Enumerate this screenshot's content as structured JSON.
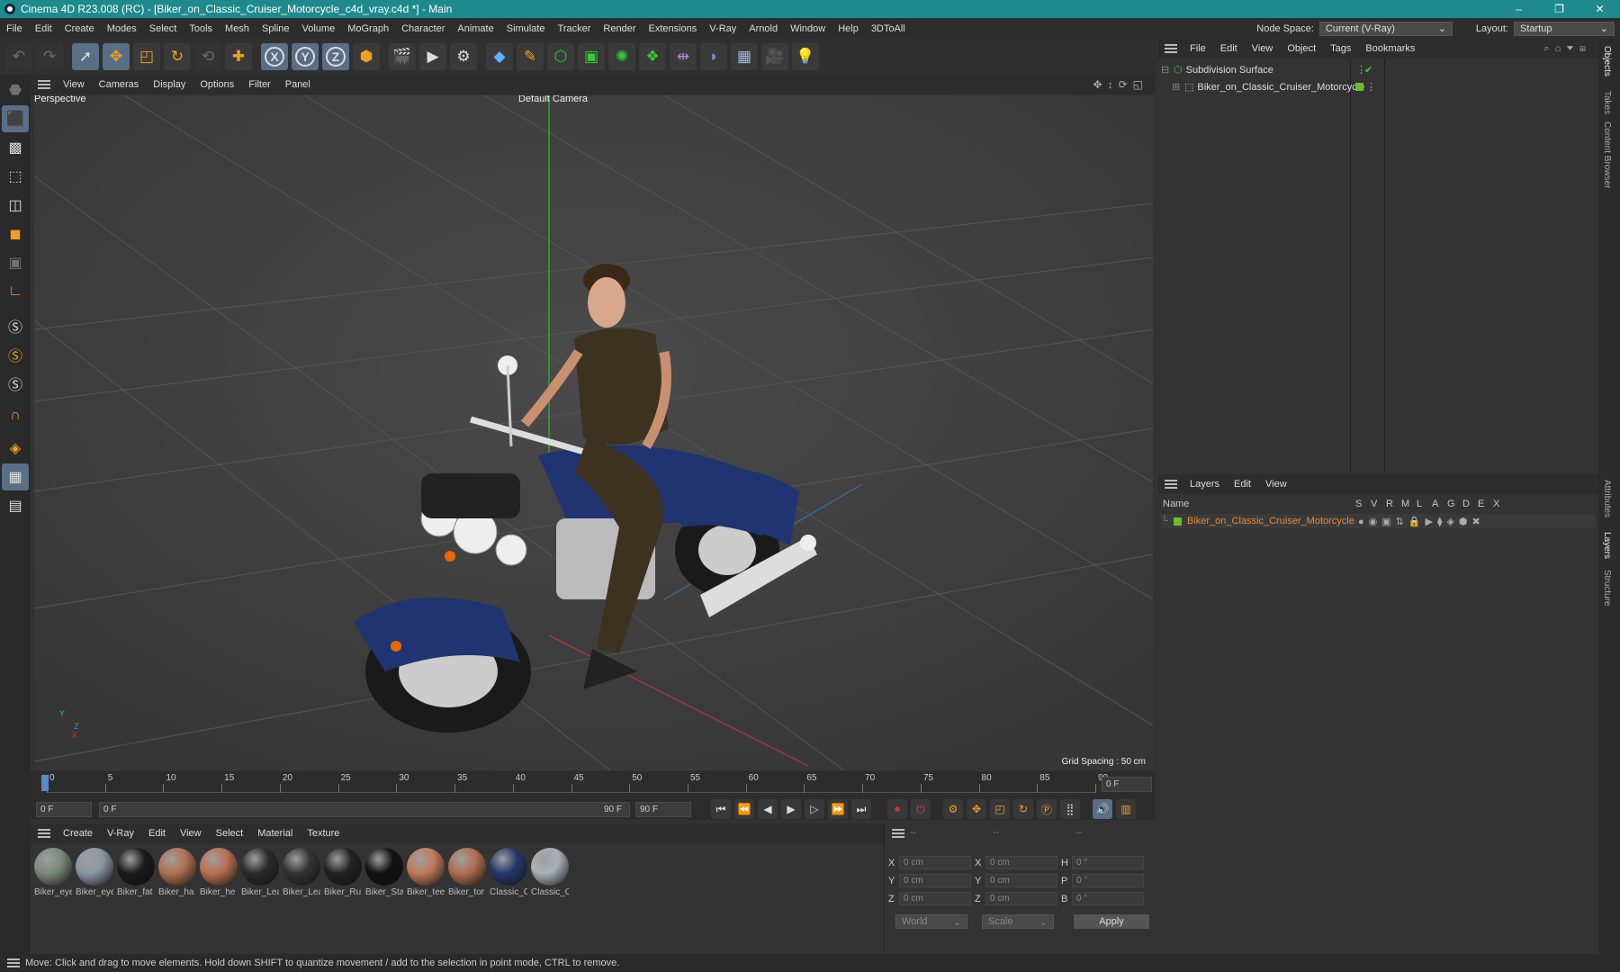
{
  "window": {
    "title": "Cinema 4D R23.008 (RC) - [Biker_on_Classic_Cruiser_Motorcycle_c4d_vray.c4d *] - Main",
    "controls": [
      "–",
      "❐",
      "✕"
    ]
  },
  "menubar": {
    "items": [
      "File",
      "Edit",
      "Create",
      "Modes",
      "Select",
      "Tools",
      "Mesh",
      "Spline",
      "Volume",
      "MoGraph",
      "Character",
      "Animate",
      "Simulate",
      "Tracker",
      "Render",
      "Extensions",
      "V-Ray",
      "Arnold",
      "Window",
      "Help",
      "3DToAll"
    ],
    "node_space_label": "Node Space:",
    "node_space_value": "Current (V-Ray)",
    "layout_label": "Layout:",
    "layout_value": "Startup"
  },
  "toolbar": {
    "icons": [
      "undo-icon",
      "redo-icon",
      "select-arrow-icon",
      "move-icon",
      "scale-icon",
      "rotate-icon",
      "recent-tool-icon",
      "add-icon",
      "axis-x-icon",
      "axis-y-icon",
      "axis-z-icon",
      "coord-system-icon",
      "render-region-icon",
      "render-view-icon",
      "render-settings-icon",
      "cube-icon",
      "pen-icon",
      "subdivision-icon",
      "extrude-icon",
      "cloner-icon",
      "array-icon",
      "deformer-icon",
      "field-icon",
      "floor-icon",
      "camera-icon",
      "light-icon"
    ],
    "axis_labels": [
      "X",
      "Y",
      "Z"
    ]
  },
  "viewport_menu": [
    "View",
    "Cameras",
    "Display",
    "Options",
    "Filter",
    "Panel"
  ],
  "viewport": {
    "name": "Perspective",
    "camera": "Default Camera",
    "grid_spacing": "Grid Spacing : 50 cm",
    "axis_y": "Y",
    "axis_z": "Z",
    "axis_x": "X"
  },
  "timeline": {
    "ticks": [
      "0",
      "5",
      "10",
      "15",
      "20",
      "25",
      "30",
      "35",
      "40",
      "45",
      "50",
      "55",
      "60",
      "65",
      "70",
      "75",
      "80",
      "85",
      "90"
    ],
    "current_frame": "0 F"
  },
  "playbar": {
    "start": "0 F",
    "range_start": "0 F",
    "range_end": "90 F",
    "end": "90 F"
  },
  "material_menu": [
    "Create",
    "V-Ray",
    "Edit",
    "View",
    "Select",
    "Material",
    "Texture"
  ],
  "materials": [
    {
      "name": "Biker_eye",
      "color": "#7a8a7a"
    },
    {
      "name": "Biker_eye",
      "color": "#8a96a4"
    },
    {
      "name": "Biker_fat",
      "color": "#1a1a1a"
    },
    {
      "name": "Biker_ha",
      "color": "#b07050"
    },
    {
      "name": "Biker_he",
      "color": "#b87050"
    },
    {
      "name": "Biker_Lea",
      "color": "#2a2a2a"
    },
    {
      "name": "Biker_Lea",
      "color": "#333"
    },
    {
      "name": "Biker_Ru",
      "color": "#222"
    },
    {
      "name": "Biker_Sta",
      "color": "#111"
    },
    {
      "name": "Biker_tee",
      "color": "#c07a5a"
    },
    {
      "name": "Biker_tor",
      "color": "#b06e50"
    },
    {
      "name": "Classic_C",
      "color": "#24386a"
    },
    {
      "name": "Classic_C",
      "color": "#aab0b8"
    }
  ],
  "coords": {
    "headers": [
      "--",
      "--",
      "--"
    ],
    "rows": [
      {
        "a": "X",
        "av": "0 cm",
        "b": "X",
        "bv": "0 cm",
        "c": "H",
        "cv": "0 °"
      },
      {
        "a": "Y",
        "av": "0 cm",
        "b": "Y",
        "bv": "0 cm",
        "c": "P",
        "cv": "0 °"
      },
      {
        "a": "Z",
        "av": "0 cm",
        "b": "Z",
        "bv": "0 cm",
        "c": "B",
        "cv": "0 °"
      }
    ],
    "mode": "World",
    "scale": "Scale",
    "apply": "Apply"
  },
  "objects": {
    "menu": [
      "File",
      "Edit",
      "View",
      "Object",
      "Tags",
      "Bookmarks"
    ],
    "items": [
      {
        "name": "Subdivision Surface"
      },
      {
        "name": "Biker_on_Classic_Cruiser_Motorcycle"
      }
    ]
  },
  "layers": {
    "menu": [
      "Layers",
      "Edit",
      "View"
    ],
    "columns": {
      "name": "Name",
      "flags": [
        "S",
        "V",
        "R",
        "M",
        "L",
        "A",
        "G",
        "D",
        "E",
        "X"
      ]
    },
    "items": [
      {
        "name": "Biker_on_Classic_Cruiser_Motorcycle"
      }
    ]
  },
  "right_tabs": [
    "Objects",
    "Takes",
    "Content Browser",
    "Attributes",
    "Layers",
    "Structure"
  ],
  "status": "Move: Click and drag to move elements. Hold down SHIFT to quantize movement / add to the selection in point mode, CTRL to remove.",
  "colors": {
    "titlebar": "#1e8a8e",
    "accent": "#5a6e86",
    "layer_color": "#6dbb2e",
    "layer_text": "#e88a3a"
  }
}
